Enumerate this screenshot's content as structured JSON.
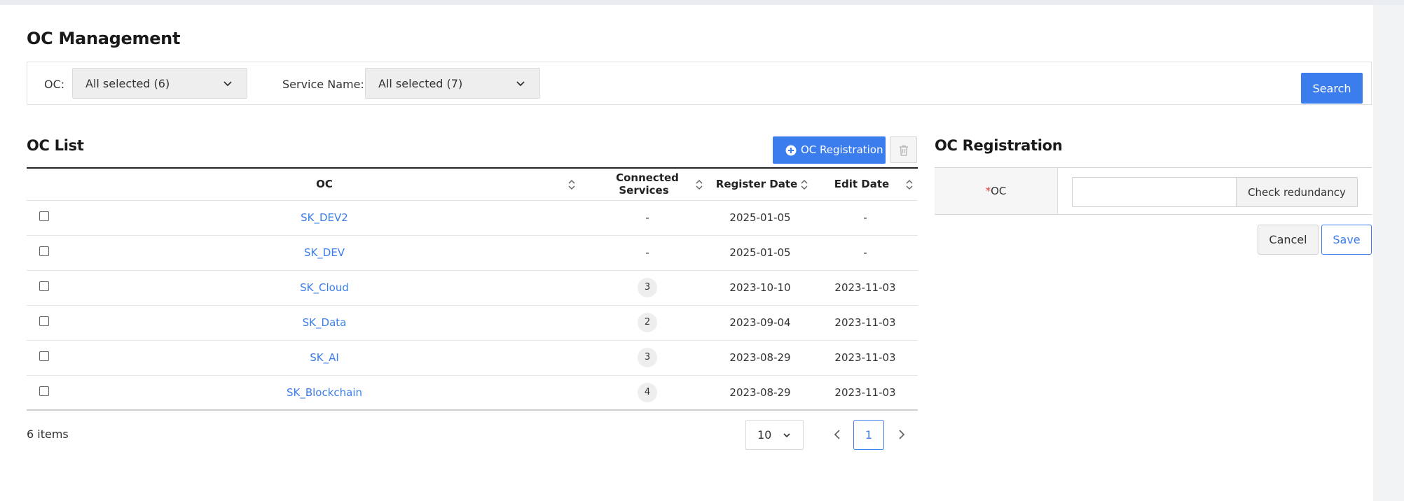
{
  "page": {
    "title": "OC Management"
  },
  "filters": {
    "oc_label": "OC:",
    "oc_value": "All selected (6)",
    "service_label": "Service Name:",
    "service_value": "All selected (7)",
    "search_label": "Search"
  },
  "oc_list": {
    "title": "OC List",
    "register_button": "OC Registration",
    "columns": [
      "OC",
      "Connected Services",
      "Register Date",
      "Edit Date"
    ],
    "rows": [
      {
        "oc": "SK_DEV2",
        "services": "-",
        "register": "2025-01-05",
        "edit": "-"
      },
      {
        "oc": "SK_DEV",
        "services": "-",
        "register": "2025-01-05",
        "edit": "-"
      },
      {
        "oc": "SK_Cloud",
        "services": "3",
        "register": "2023-10-10",
        "edit": "2023-11-03"
      },
      {
        "oc": "SK_Data",
        "services": "2",
        "register": "2023-09-04",
        "edit": "2023-11-03"
      },
      {
        "oc": "SK_AI",
        "services": "3",
        "register": "2023-08-29",
        "edit": "2023-11-03"
      },
      {
        "oc": "SK_Blockchain",
        "services": "4",
        "register": "2023-08-29",
        "edit": "2023-11-03"
      }
    ],
    "items_count": "6 items",
    "page_size": "10",
    "current_page": "1"
  },
  "registration": {
    "title": "OC Registration",
    "required_mark": "*",
    "field_label": "OC",
    "field_value": "",
    "check_button": "Check redundancy",
    "cancel_button": "Cancel",
    "save_button": "Save"
  },
  "colors": {
    "accent": "#3b7ded",
    "required": "#e53935"
  }
}
